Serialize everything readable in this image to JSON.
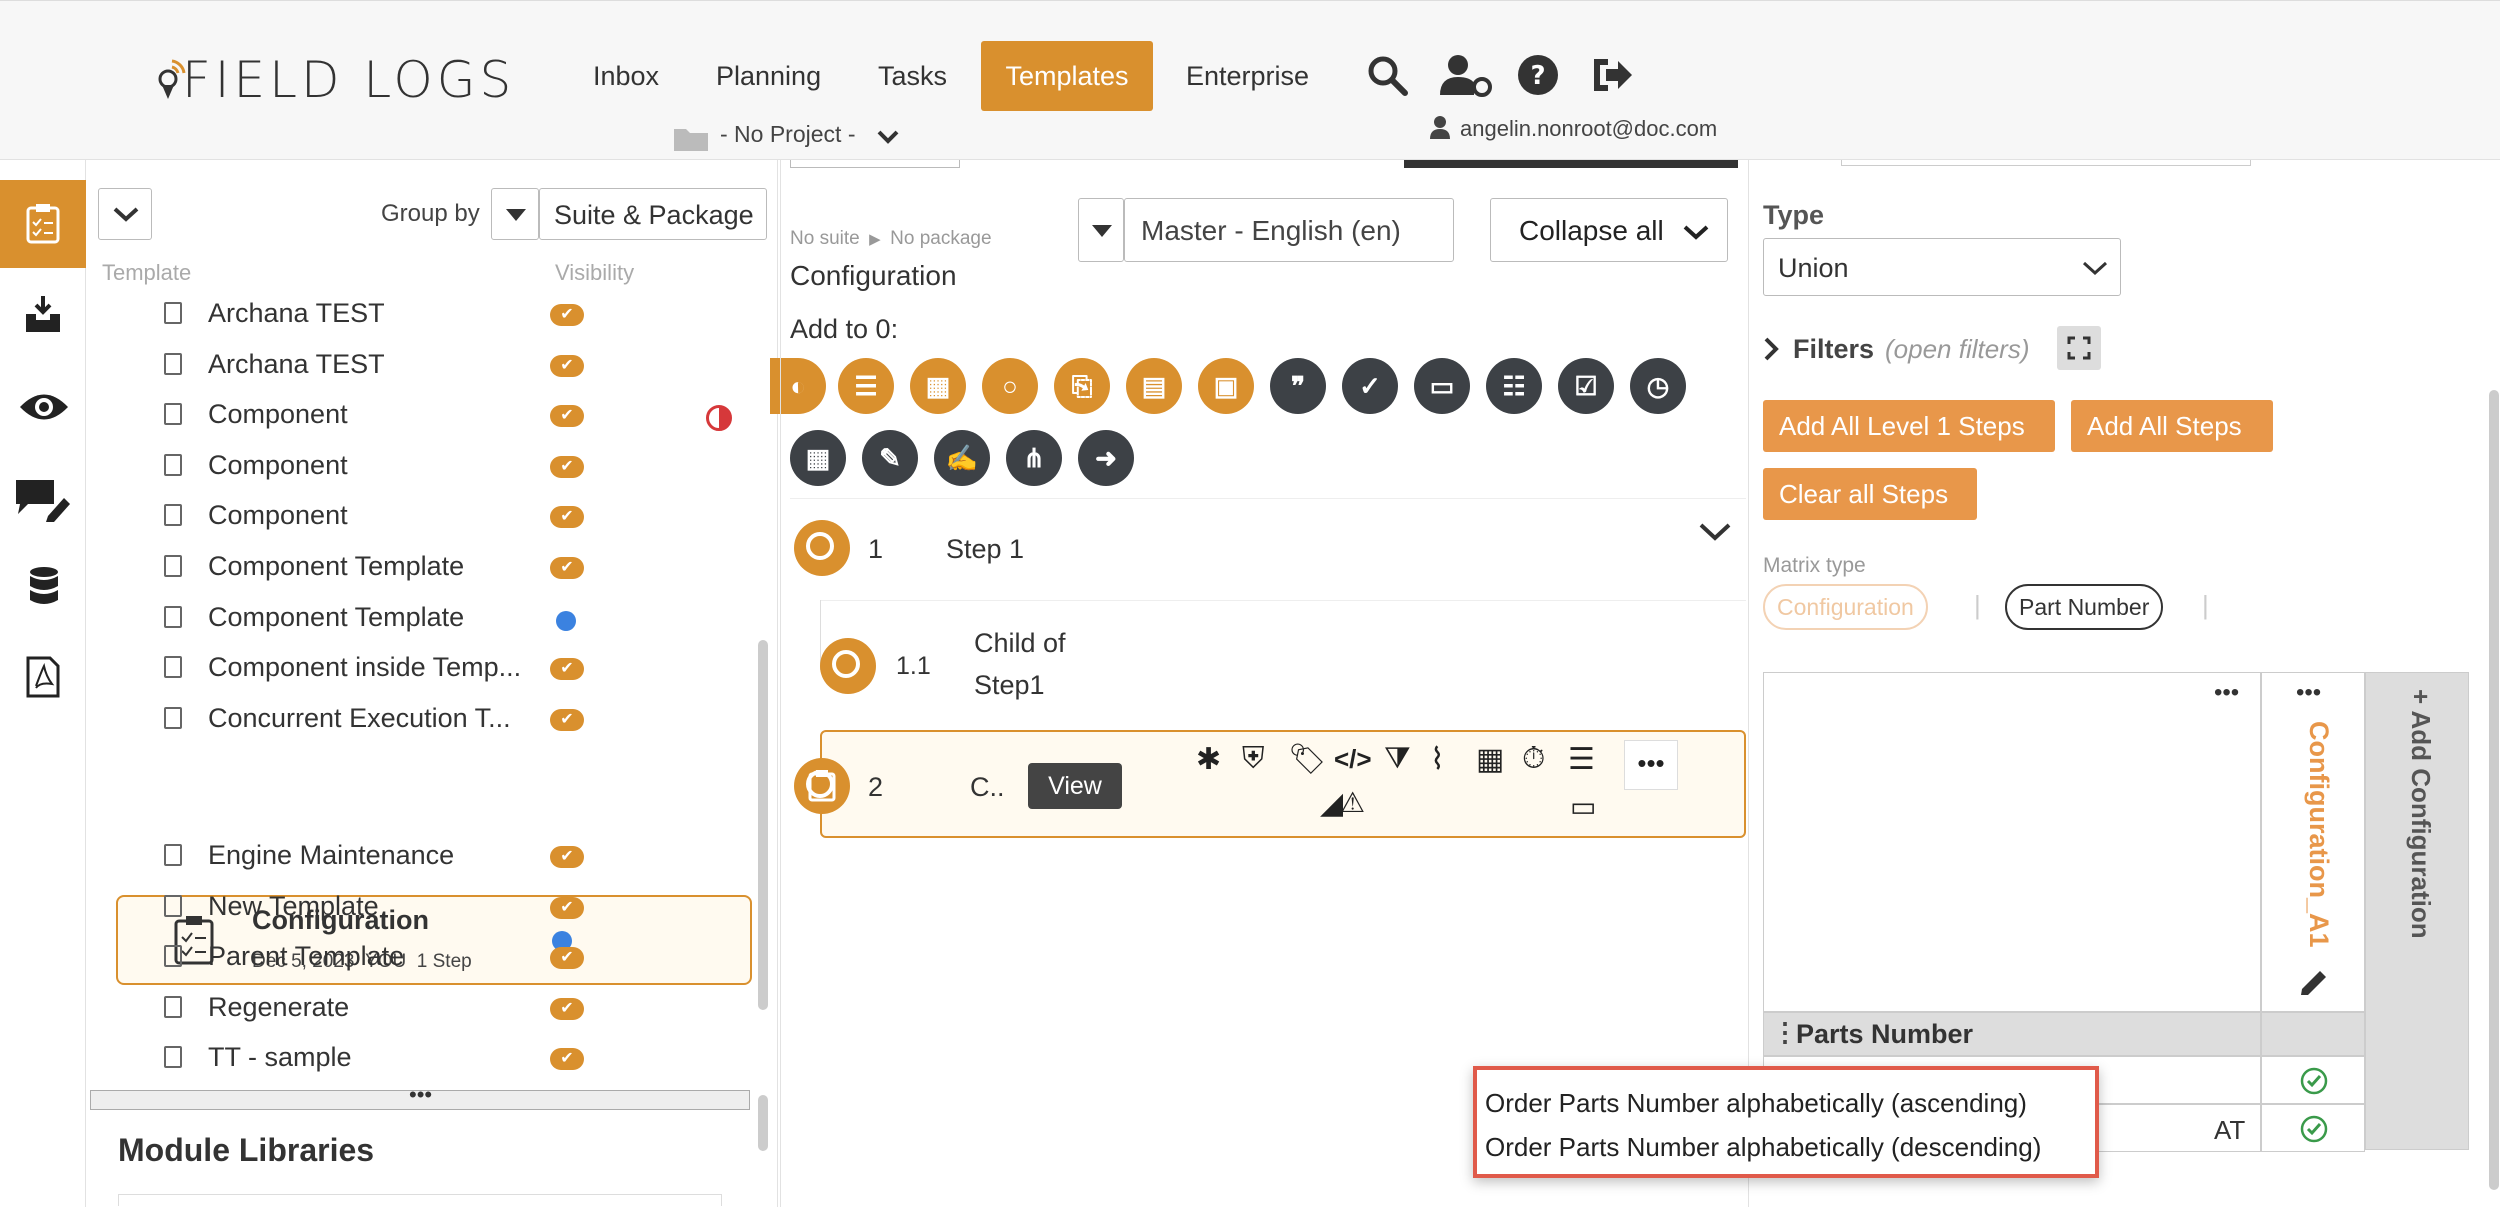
{
  "header": {
    "brand": "FIELD LOGS",
    "nav": [
      "Inbox",
      "Planning",
      "Tasks",
      "Templates",
      "Enterprise"
    ],
    "active_nav": "Templates",
    "project": "- No Project -",
    "user_email": "angelin.nonroot@doc.com",
    "icons": [
      "search-icon",
      "user-settings-icon",
      "help-icon",
      "logout-icon"
    ]
  },
  "rail": {
    "icons": [
      "templates-icon",
      "inbox-download-icon",
      "view-icon",
      "comments-edit-icon",
      "database-icon",
      "pdf-icon"
    ]
  },
  "template_panel": {
    "group_by_label": "Group by",
    "group_by_value": "Suite & Package",
    "col_template": "Template",
    "col_visibility": "Visibility",
    "rows": [
      {
        "name": "Archana TEST",
        "vis": "check"
      },
      {
        "name": "Archana TEST",
        "vis": "check"
      },
      {
        "name": "Component",
        "vis": "check",
        "flag": "half-circle"
      },
      {
        "name": "Component",
        "vis": "check"
      },
      {
        "name": "Component",
        "vis": "check"
      },
      {
        "name": "Component Template",
        "vis": "check"
      },
      {
        "name": "Component Template",
        "vis": "dot"
      },
      {
        "name": "Component inside Temp...",
        "vis": "check"
      },
      {
        "name": "Concurrent Execution T...",
        "vis": "check"
      }
    ],
    "selected": {
      "name": "Configuration",
      "date": "Dec 5, 2023",
      "owner": "YOU",
      "steps": "1 Step"
    },
    "rows_after": [
      {
        "name": "Engine Maintenance",
        "vis": "check"
      },
      {
        "name": "New Template",
        "vis": "check"
      },
      {
        "name": "Parent Template",
        "vis": "check"
      },
      {
        "name": "Regenerate",
        "vis": "check"
      },
      {
        "name": "TT - sample",
        "vis": "check"
      }
    ],
    "module_libraries": "Module Libraries"
  },
  "center": {
    "breadcrumb_suite": "No suite",
    "breadcrumb_package": "No package",
    "title": "Configuration",
    "language": "Master - English (en)",
    "collapse_label": "Collapse all",
    "add_to_label": "Add to 0:",
    "steps": [
      {
        "num": "1",
        "label": "Step 1"
      },
      {
        "num": "1.1",
        "label_line1": "Child of",
        "label_line2": "Step1"
      },
      {
        "num": "2",
        "label": "C..",
        "view": "View"
      }
    ]
  },
  "right": {
    "type_label": "Type",
    "type_value": "Union",
    "filters_label": "Filters",
    "filters_hint": "(open filters)",
    "btn_add_level1": "Add All Level 1 Steps",
    "btn_add_all": "Add All Steps",
    "btn_clear": "Clear all Steps",
    "matrix_type_label": "Matrix type",
    "matrix_pill_config": "Configuration",
    "matrix_pill_part": "Part Number",
    "column_config": "Configuration_A1",
    "add_config": "+ Add Configuration",
    "parts_number": "Parts Number",
    "row2_partial": "AT"
  },
  "context_menu": {
    "items": [
      "Order Parts Number alphabetically (ascending)",
      "Order Parts Number alphabetically (descending)"
    ]
  }
}
